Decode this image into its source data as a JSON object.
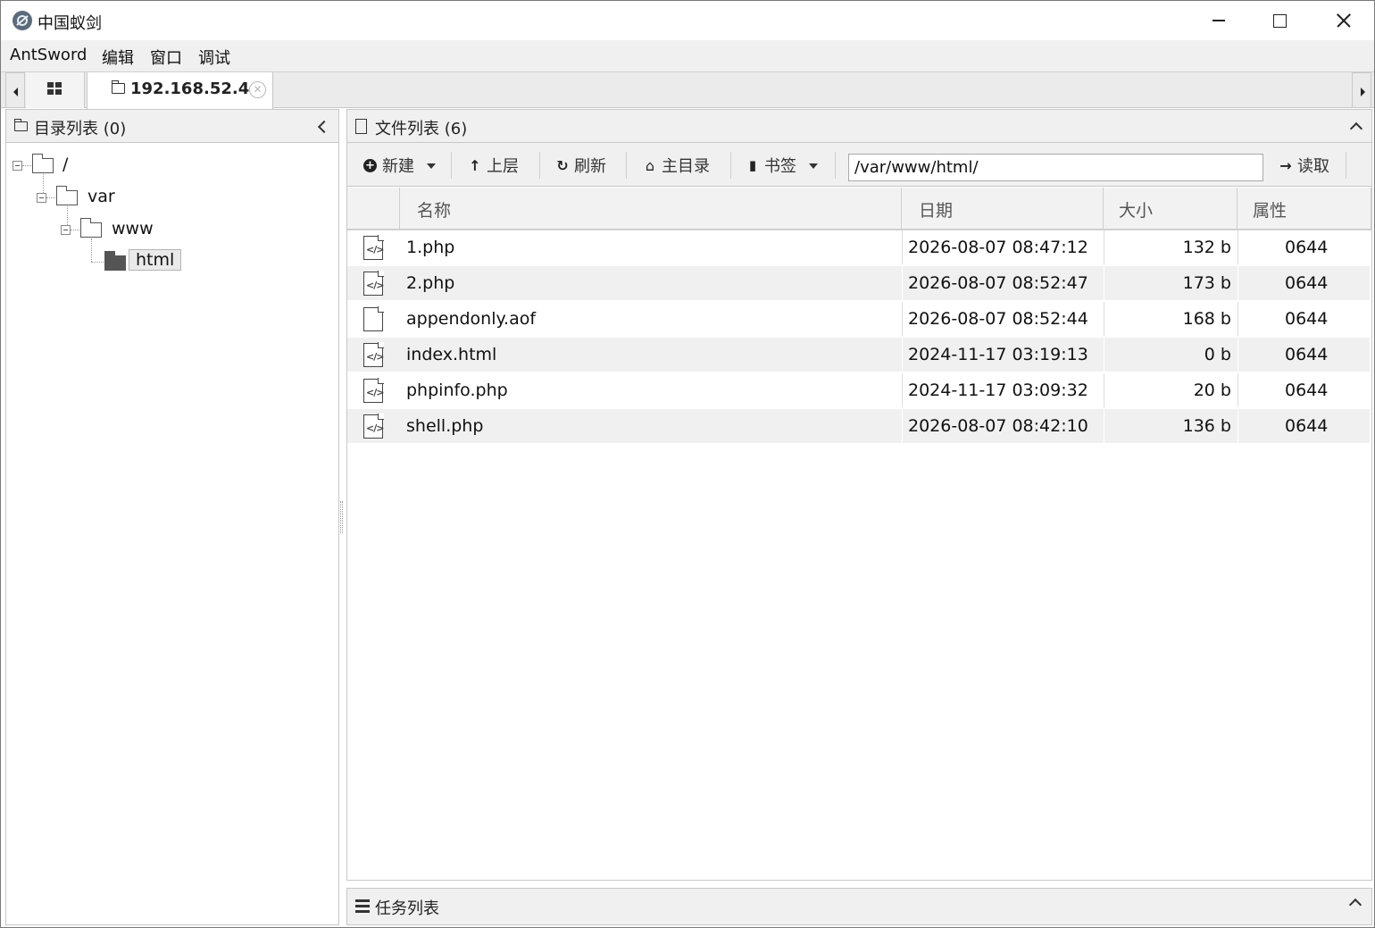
{
  "window": {
    "title": "中国蚁剑"
  },
  "menu": {
    "items": [
      "AntSword",
      "编辑",
      "窗口",
      "调试"
    ]
  },
  "tabs": {
    "active_label": "192.168.52.4",
    "close_glyph": "✕"
  },
  "dir_panel": {
    "title": "目录列表 (0)",
    "tree": [
      {
        "label": "/",
        "level": 0
      },
      {
        "label": "var",
        "level": 1
      },
      {
        "label": "www",
        "level": 2
      },
      {
        "label": "html",
        "level": 3,
        "selected": true
      }
    ]
  },
  "file_panel": {
    "title": "文件列表 (6)",
    "toolbar": {
      "new_label": "新建",
      "up_label": "上层",
      "refresh_label": "刷新",
      "home_label": "主目录",
      "bookmark_label": "书签",
      "path_value": "/var/www/html/",
      "read_label": "读取"
    },
    "columns": [
      "名称",
      "日期",
      "大小",
      "属性"
    ],
    "rows": [
      {
        "icon": "code-file-icon",
        "name": "1.php",
        "date": "2026-08-07 08:47:12",
        "size": "132 b",
        "perm": "0644"
      },
      {
        "icon": "code-file-icon",
        "name": "2.php",
        "date": "2026-08-07 08:52:47",
        "size": "173 b",
        "perm": "0644"
      },
      {
        "icon": "file-icon",
        "name": "appendonly.aof",
        "date": "2026-08-07 08:52:44",
        "size": "168 b",
        "perm": "0644"
      },
      {
        "icon": "code-file-icon",
        "name": "index.html",
        "date": "2024-11-17 03:19:13",
        "size": "0 b",
        "perm": "0644"
      },
      {
        "icon": "code-file-icon",
        "name": "phpinfo.php",
        "date": "2024-11-17 03:09:32",
        "size": "20 b",
        "perm": "0644"
      },
      {
        "icon": "code-file-icon",
        "name": "shell.php",
        "date": "2026-08-07 08:42:10",
        "size": "136 b",
        "perm": "0644"
      }
    ]
  },
  "task_panel": {
    "title": "任务列表"
  },
  "colors": {
    "header_bg": "#f0f0f0",
    "row_alt_bg": "#f0f0f0",
    "border": "#c8c8c8"
  }
}
